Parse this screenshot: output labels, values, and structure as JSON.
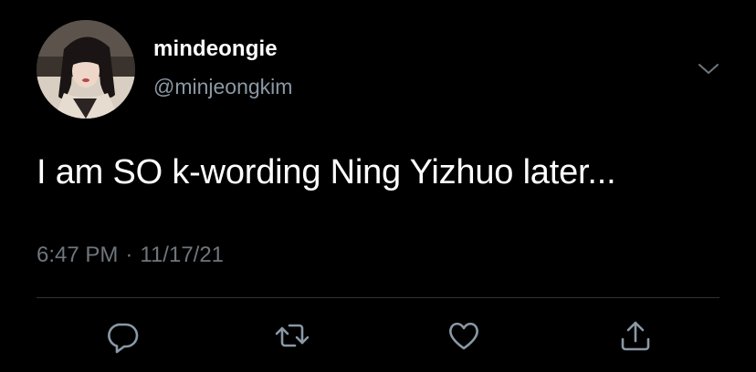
{
  "tweet": {
    "author": {
      "display_name": "mindeongie",
      "handle": "@minjeongkim",
      "avatar_icon": "profile-photo"
    },
    "text": "I am SO k-wording Ning Yizhuo later...",
    "time": "6:47 PM",
    "separator": "·",
    "date": "11/17/21"
  },
  "actions": [
    {
      "name": "reply",
      "icon": "speech-bubble-icon"
    },
    {
      "name": "retweet",
      "icon": "retweet-arrows-icon"
    },
    {
      "name": "like",
      "icon": "heart-icon"
    },
    {
      "name": "share",
      "icon": "share-upload-icon"
    }
  ],
  "colors": {
    "background": "#000000",
    "text_primary": "#ffffff",
    "text_secondary": "#8b98a5",
    "meta": "#6e767d",
    "icon": "#8b98a5",
    "divider": "#2f3336"
  }
}
